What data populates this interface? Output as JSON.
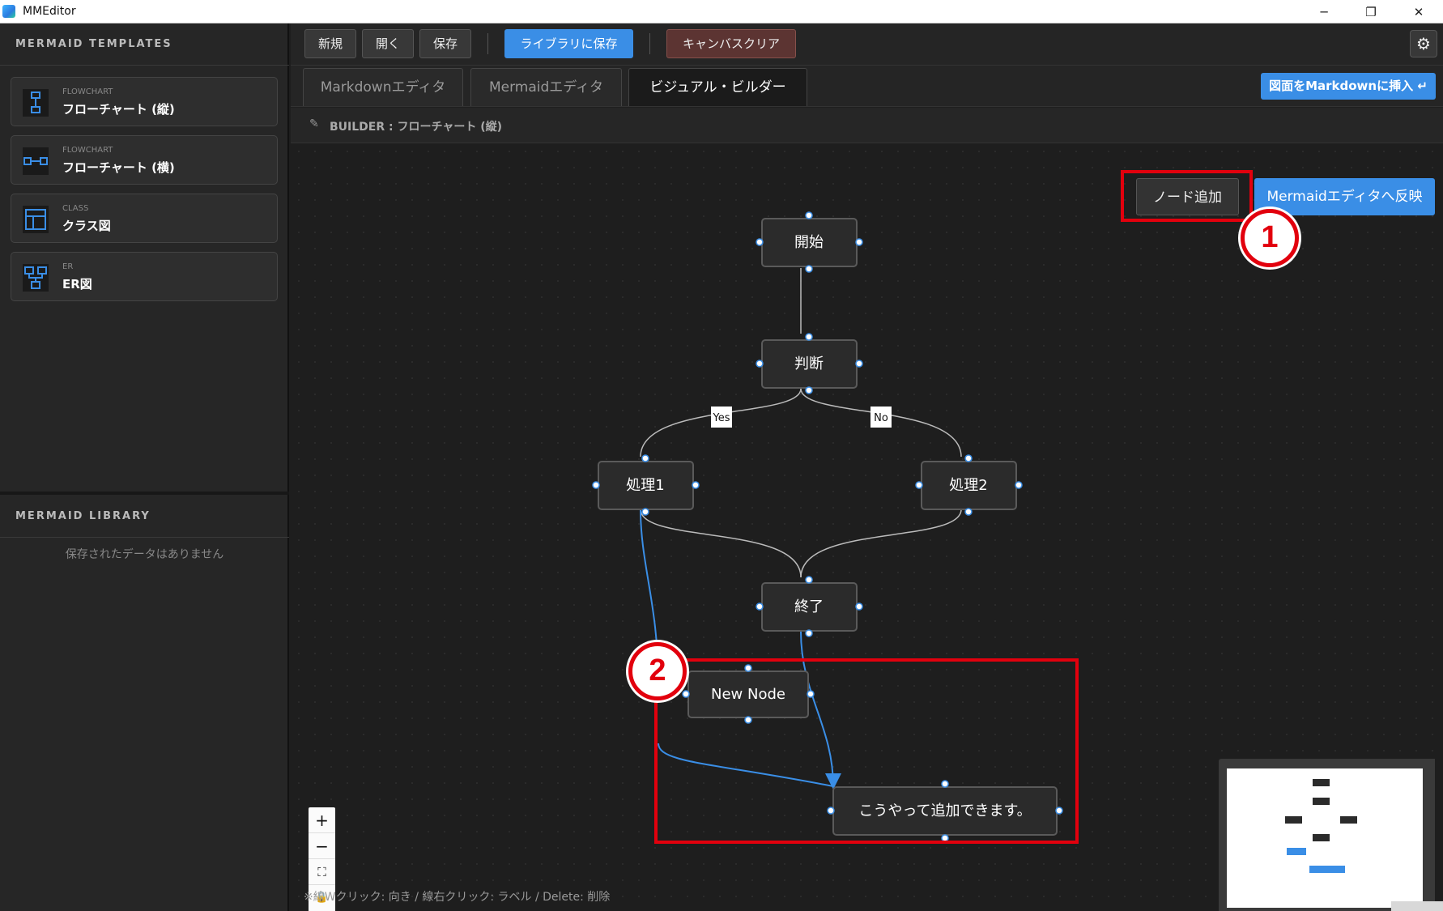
{
  "window": {
    "title": "MMEditor",
    "controls": [
      "─",
      "❐",
      "✕"
    ]
  },
  "sidebar": {
    "templates_title": "MERMAID TEMPLATES",
    "templates": [
      {
        "category": "FLOWCHART",
        "name": "フローチャート (縦)",
        "icon": "flowchart-vertical-icon"
      },
      {
        "category": "FLOWCHART",
        "name": "フローチャート (横)",
        "icon": "flowchart-horizontal-icon"
      },
      {
        "category": "CLASS",
        "name": "クラス図",
        "icon": "class-diagram-icon"
      },
      {
        "category": "ER",
        "name": "ER図",
        "icon": "er-diagram-icon"
      }
    ],
    "library_title": "MERMAID LIBRARY",
    "library_empty": "保存されたデータはありません"
  },
  "toolbar": {
    "new": "新規",
    "open": "開く",
    "save": "保存",
    "save_library": "ライブラリに保存",
    "clear_canvas": "キャンバスクリア",
    "settings_icon": "gear-icon"
  },
  "tabs": [
    {
      "label": "Markdownエディタ"
    },
    {
      "label": "Mermaidエディタ"
    },
    {
      "label": "ビジュアル・ビルダー",
      "active": true
    }
  ],
  "insert_button": "図面をMarkdownに挿入 ↵",
  "breadcrumb": "BUILDER : フローチャート (縦)",
  "canvas": {
    "add_node": "ノード追加",
    "reflect": "Mermaidエディタへ反映",
    "nodes": {
      "start": "開始",
      "decision": "判断",
      "proc1": "処理1",
      "proc2": "処理2",
      "end": "終了",
      "new_node": "New Node",
      "added": "こうやって追加できます。"
    },
    "edge_labels": {
      "yes": "Yes",
      "no": "No"
    },
    "zoom": [
      "+",
      "−",
      "⛶",
      "🔒"
    ],
    "hint": "※線Wクリック: 向き / 線右クリック: ラベル / Delete: 削除"
  },
  "annotations": [
    "1",
    "2"
  ],
  "colors": {
    "accent": "#3a8ee6",
    "annotation": "#e2000d",
    "danger_bg": "#5c3432"
  }
}
